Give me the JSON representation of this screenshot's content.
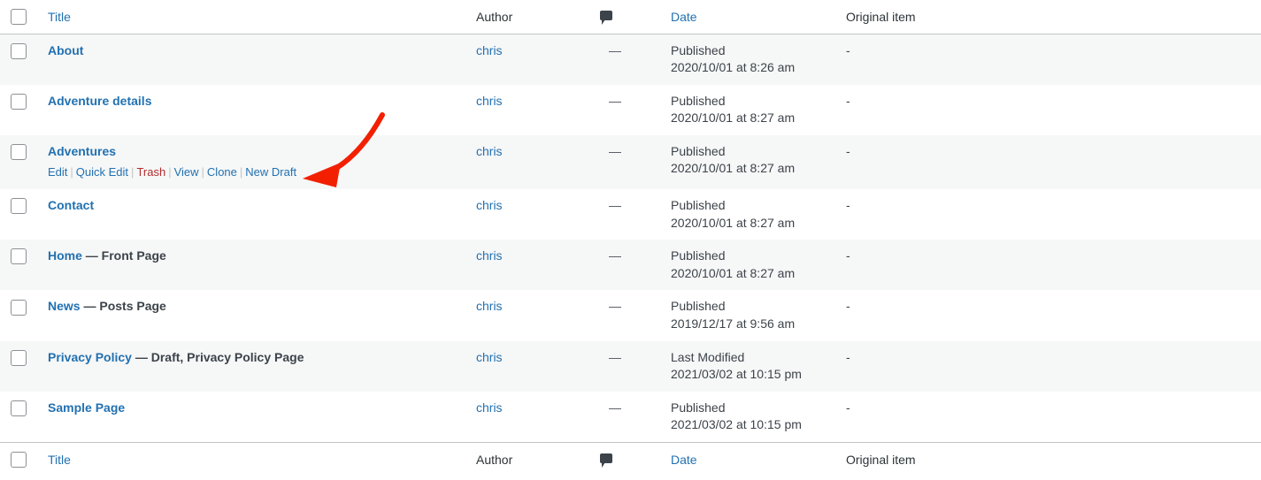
{
  "table": {
    "columns": [
      {
        "key": "cb",
        "label": "",
        "sortable": false,
        "icon": "checkbox"
      },
      {
        "key": "title",
        "label": "Title",
        "sortable": true
      },
      {
        "key": "author",
        "label": "Author",
        "sortable": false
      },
      {
        "key": "comments",
        "label": "",
        "sortable": false,
        "icon": "comment-bubble-icon"
      },
      {
        "key": "date",
        "label": "Date",
        "sortable": true
      },
      {
        "key": "orig",
        "label": "Original item",
        "sortable": false
      }
    ],
    "rows": [
      {
        "title": "About",
        "state": "",
        "author": "chris",
        "comments": "—",
        "date_status": "Published",
        "date_value": "2020/10/01 at 8:26 am",
        "original_item": "-",
        "actions": []
      },
      {
        "title": "Adventure details",
        "state": "",
        "author": "chris",
        "comments": "—",
        "date_status": "Published",
        "date_value": "2020/10/01 at 8:27 am",
        "original_item": "-",
        "actions": []
      },
      {
        "title": "Adventures",
        "state": "",
        "author": "chris",
        "comments": "—",
        "date_status": "Published",
        "date_value": "2020/10/01 at 8:27 am",
        "original_item": "-",
        "actions": [
          "Edit",
          "Quick Edit",
          "Trash",
          "View",
          "Clone",
          "New Draft"
        ]
      },
      {
        "title": "Contact",
        "state": "",
        "author": "chris",
        "comments": "—",
        "date_status": "Published",
        "date_value": "2020/10/01 at 8:27 am",
        "original_item": "-",
        "actions": []
      },
      {
        "title": "Home",
        "state": "— Front Page",
        "author": "chris",
        "comments": "—",
        "date_status": "Published",
        "date_value": "2020/10/01 at 8:27 am",
        "original_item": "-",
        "actions": []
      },
      {
        "title": "News",
        "state": "— Posts Page",
        "author": "chris",
        "comments": "—",
        "date_status": "Published",
        "date_value": "2019/12/17 at 9:56 am",
        "original_item": "-",
        "actions": []
      },
      {
        "title": "Privacy Policy",
        "state": "— Draft, Privacy Policy Page",
        "author": "chris",
        "comments": "—",
        "date_status": "Last Modified",
        "date_value": "2021/03/02 at 10:15 pm",
        "original_item": "-",
        "actions": []
      },
      {
        "title": "Sample Page",
        "state": "",
        "author": "chris",
        "comments": "—",
        "date_status": "Published",
        "date_value": "2021/03/02 at 10:15 pm",
        "original_item": "-",
        "actions": []
      }
    ]
  },
  "annotation": {
    "type": "curved-arrow",
    "color": "#f22000",
    "points_to": "New Draft"
  },
  "colors": {
    "link": "#2271b1",
    "trash_link": "#b32d2e",
    "text": "#3c434a",
    "row_alt_bg": "#f6f7f7",
    "row_bg": "#ffffff",
    "border": "#c3c4c7",
    "annotation": "#f22000"
  }
}
